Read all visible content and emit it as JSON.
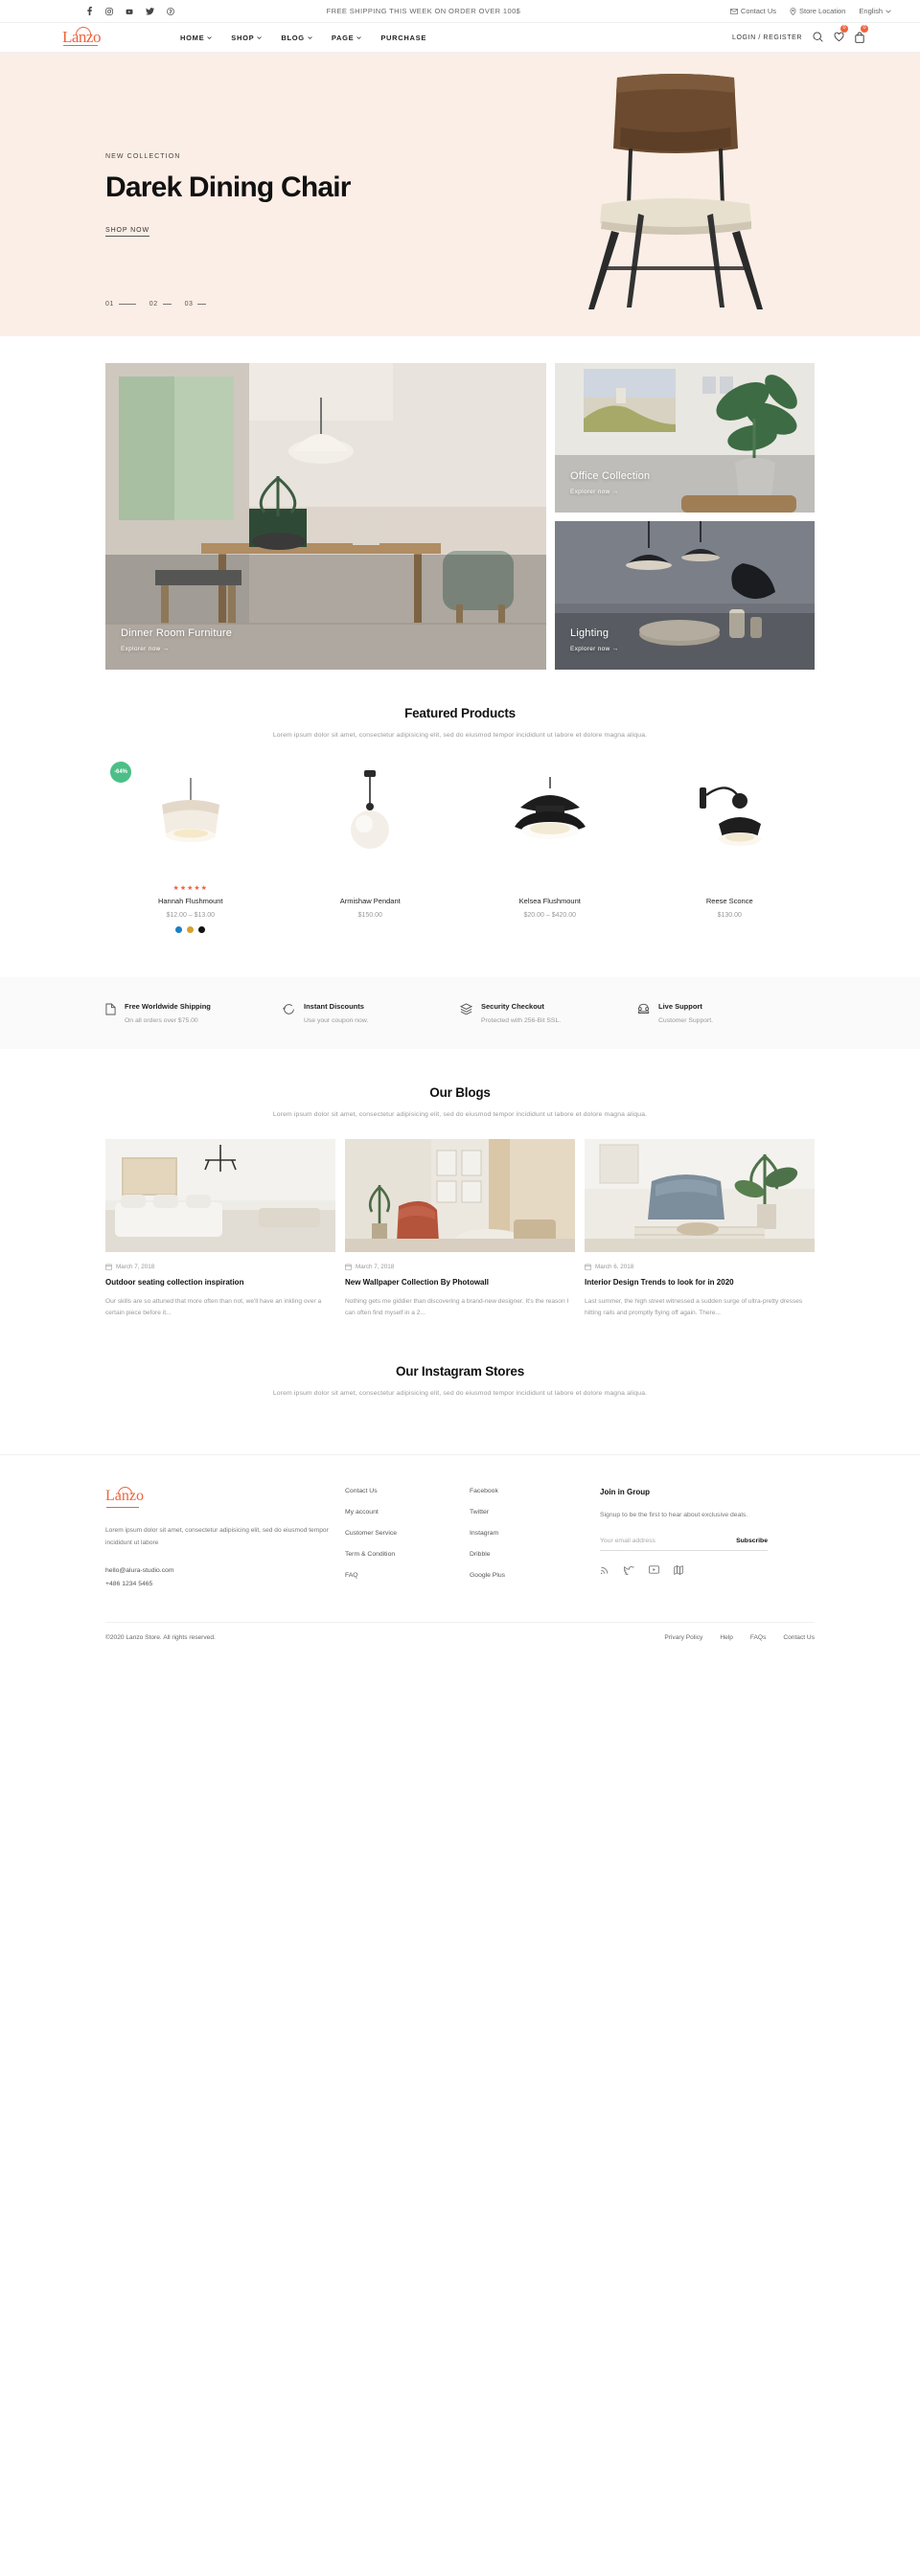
{
  "topbar": {
    "social": [
      "facebook-icon",
      "instagram-icon",
      "youtube-icon",
      "twitter-icon",
      "pinterest-icon"
    ],
    "promo": "FREE SHIPPING THIS WEEK ON ORDER OVER 100$",
    "contact": "Contact Us",
    "store_location": "Store Location",
    "language": "English"
  },
  "header": {
    "logo": "Lanzo",
    "nav": [
      {
        "label": "HOME",
        "caret": true
      },
      {
        "label": "SHOP",
        "caret": true
      },
      {
        "label": "BLOG",
        "caret": true
      },
      {
        "label": "PAGE",
        "caret": true
      },
      {
        "label": "PURCHASE",
        "caret": false
      }
    ],
    "login": "LOGIN / REGISTER",
    "wishlist_count": "0",
    "cart_count": "0"
  },
  "hero": {
    "eyebrow": "NEW COLLECTION",
    "title": "Darek Dining Chair",
    "cta": "SHOP NOW",
    "slides": [
      "01",
      "02",
      "03"
    ],
    "bg_color": "#fbeee6"
  },
  "categories": [
    {
      "title": "Dinner Room Furniture",
      "link": "Explorer now"
    },
    {
      "title": "Office Collection",
      "link": "Explorer now"
    },
    {
      "title": "Lighting",
      "link": "Explorer now"
    }
  ],
  "featured": {
    "title": "Featured Products",
    "subtitle": "Lorem ipsum dolor sit amet, consectetur adipisicing elit, sed do eiusmod tempor incididunt ut labore et dolore magna aliqua.",
    "products": [
      {
        "name": "Hannah Flushmount",
        "price": "$12.00 – $13.00",
        "badge": "-64%",
        "rating": "★★★★★",
        "swatches": [
          "#1b7fc4",
          "#d6a12c",
          "#111111"
        ]
      },
      {
        "name": "Armishaw Pendant",
        "price": "$150.00",
        "badge": "",
        "rating": "",
        "swatches": []
      },
      {
        "name": "Kelsea Flushmount",
        "price": "$20.00 – $420.00",
        "badge": "",
        "rating": "",
        "swatches": []
      },
      {
        "name": "Reese Sconce",
        "price": "$130.00",
        "badge": "",
        "rating": "",
        "swatches": []
      }
    ]
  },
  "services": [
    {
      "icon": "document-icon",
      "title": "Free Worldwide Shipping",
      "sub": "On all orders over $75.00"
    },
    {
      "icon": "refresh-icon",
      "title": "Instant Discounts",
      "sub": "Use your coupon now."
    },
    {
      "icon": "layers-icon",
      "title": "Security Checkout",
      "sub": "Protected with 256-Bit SSL."
    },
    {
      "icon": "phone-icon",
      "title": "Live Support",
      "sub": "Customer Support."
    }
  ],
  "blogs": {
    "title": "Our Blogs",
    "subtitle": "Lorem ipsum dolor sit amet, consectetur adipisicing elit, sed do eiusmod tempor incididunt ut labore et dolore magna aliqua.",
    "posts": [
      {
        "date": "March 7, 2018",
        "title": "Outdoor seating collection inspiration",
        "excerpt": "Our skills are so attuned that more often than not, we'll have an inkling over a certain piece before it..."
      },
      {
        "date": "March 7, 2018",
        "title": "New Wallpaper Collection By Photowall",
        "excerpt": "Nothing gets me giddier than discovering a brand-new designer. It's the reason I can often find myself in a 2..."
      },
      {
        "date": "March 6, 2018",
        "title": "Interior Design Trends to look for in 2020",
        "excerpt": "Last summer, the high street witnessed a sudden surge of ultra-pretty dresses hitting rails and promptly flying off again. There..."
      }
    ]
  },
  "instagram": {
    "title": "Our Instagram Stores",
    "subtitle": "Lorem ipsum dolor sit amet, consectetur adipisicing elit, sed do eiusmod tempor incididunt ut labore et dolore magna aliqua."
  },
  "footer": {
    "logo": "Lanzo",
    "description": "Lorem ipsum dolor sit amet, consectetur adipisicing elit, sed do eiusmod tempor incididunt ut labore",
    "email": "hello@alura-studio.com",
    "phone": "+486 1234 5465",
    "col1": [
      "Contact Us",
      "My account",
      "Customer Service",
      "Term & Condition",
      "FAQ"
    ],
    "col2": [
      "Facebook",
      "Twitter",
      "Instagram",
      "Dribble",
      "Google Plus"
    ],
    "newsletter": {
      "title": "Join in Group",
      "text": "Signup to be the first to hear about exclusive deals.",
      "placeholder": "Your email address",
      "value": "",
      "button": "Subscribe"
    },
    "social": [
      "rss-icon",
      "twitter-icon",
      "video-icon",
      "map-icon"
    ],
    "copyright": "©2020 Lanzo Store. All rights reserved.",
    "links": [
      "Privary Policy",
      "Help",
      "FAQs",
      "Contact Us"
    ]
  },
  "colors": {
    "accent": "#f0623c",
    "sale": "#4bbf87",
    "hero_bg": "#fbeee6"
  }
}
